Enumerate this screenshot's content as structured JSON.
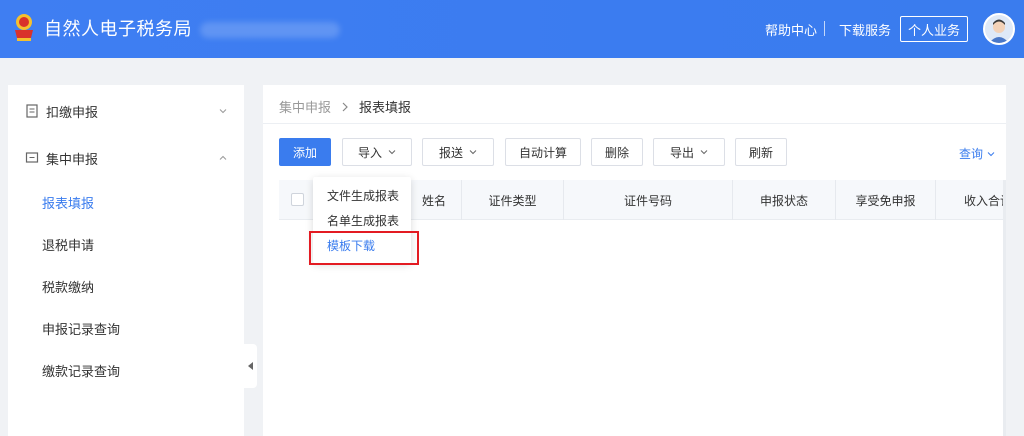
{
  "header": {
    "app_title": "自然人电子税务局",
    "help_label": "帮助中心",
    "download_label": "下载服务",
    "personal_label": "个人业务"
  },
  "sidebar": {
    "groups": [
      {
        "label": "扣缴申报"
      },
      {
        "label": "集中申报"
      }
    ],
    "sub_items": [
      {
        "label": "报表填报"
      },
      {
        "label": "退税申请"
      },
      {
        "label": "税款缴纳"
      },
      {
        "label": "申报记录查询"
      },
      {
        "label": "缴款记录查询"
      }
    ]
  },
  "breadcrumb": {
    "parent": "集中申报",
    "current": "报表填报"
  },
  "toolbar": {
    "add": "添加",
    "import": "导入",
    "submit": "报送",
    "auto_calc": "自动计算",
    "delete": "删除",
    "export": "导出",
    "refresh": "刷新",
    "query": "查询"
  },
  "table": {
    "columns": [
      "姓名",
      "证件类型",
      "证件号码",
      "申报状态",
      "享受免申报",
      "收入合计"
    ]
  },
  "import_menu": {
    "items": [
      "文件生成报表",
      "名单生成报表",
      "模板下载"
    ]
  },
  "colors": {
    "primary": "#3a7cee",
    "highlight_box": "#e31b22"
  }
}
